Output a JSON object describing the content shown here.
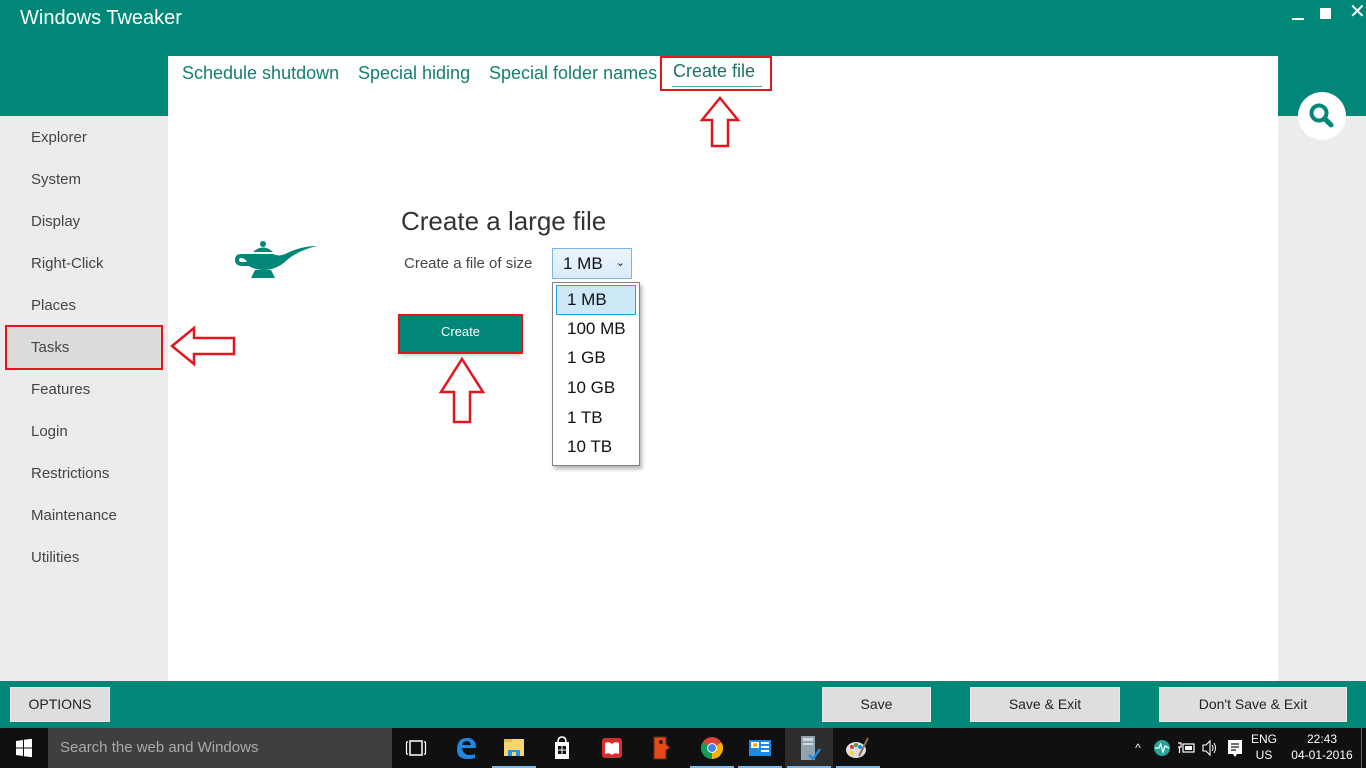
{
  "app": {
    "title": "Windows Tweaker",
    "window_controls": {
      "minimize": "minimize",
      "maximize": "maximize",
      "close": "✕"
    }
  },
  "sidebar": {
    "items": [
      {
        "label": "Explorer"
      },
      {
        "label": "System"
      },
      {
        "label": "Display"
      },
      {
        "label": "Right-Click"
      },
      {
        "label": "Places"
      },
      {
        "label": "Tasks",
        "active": true
      },
      {
        "label": "Features"
      },
      {
        "label": "Login"
      },
      {
        "label": "Restrictions"
      },
      {
        "label": "Maintenance"
      },
      {
        "label": "Utilities"
      }
    ]
  },
  "tabs": [
    {
      "label": "Schedule shutdown"
    },
    {
      "label": "Special hiding"
    },
    {
      "label": "Special folder names"
    },
    {
      "label": "Create file",
      "active": true
    }
  ],
  "main": {
    "heading": "Create a large file",
    "size_label": "Create a file of size",
    "size_select": {
      "value": "1 MB",
      "chevron": "⌄",
      "options": [
        "1 MB",
        "100 MB",
        "1 GB",
        "10 GB",
        "1 TB",
        "10 TB"
      ],
      "highlighted": "1 MB"
    },
    "create_button": "Create",
    "icon": "genie-lamp-icon"
  },
  "footer": {
    "options_button": "OPTIONS",
    "save_button": "Save",
    "save_exit_button": "Save & Exit",
    "dont_save_exit_button": "Don't Save & Exit"
  },
  "taskbar": {
    "search_placeholder": "Search the web and Windows",
    "pinned": [
      "task-view",
      "edge",
      "file-explorer",
      "store",
      "reader",
      "app-red",
      "chrome",
      "control-panel",
      "windows-tweaker",
      "paint"
    ],
    "tray": {
      "language": "ENG",
      "region": "US",
      "time": "22:43",
      "date": "04-01-2016"
    }
  },
  "colors": {
    "accent": "#008777",
    "tab_text": "#13806e",
    "annotation": "#e3161f",
    "sidebar_bg": "#ececec",
    "dropdown_selected": "#cde8f6"
  }
}
